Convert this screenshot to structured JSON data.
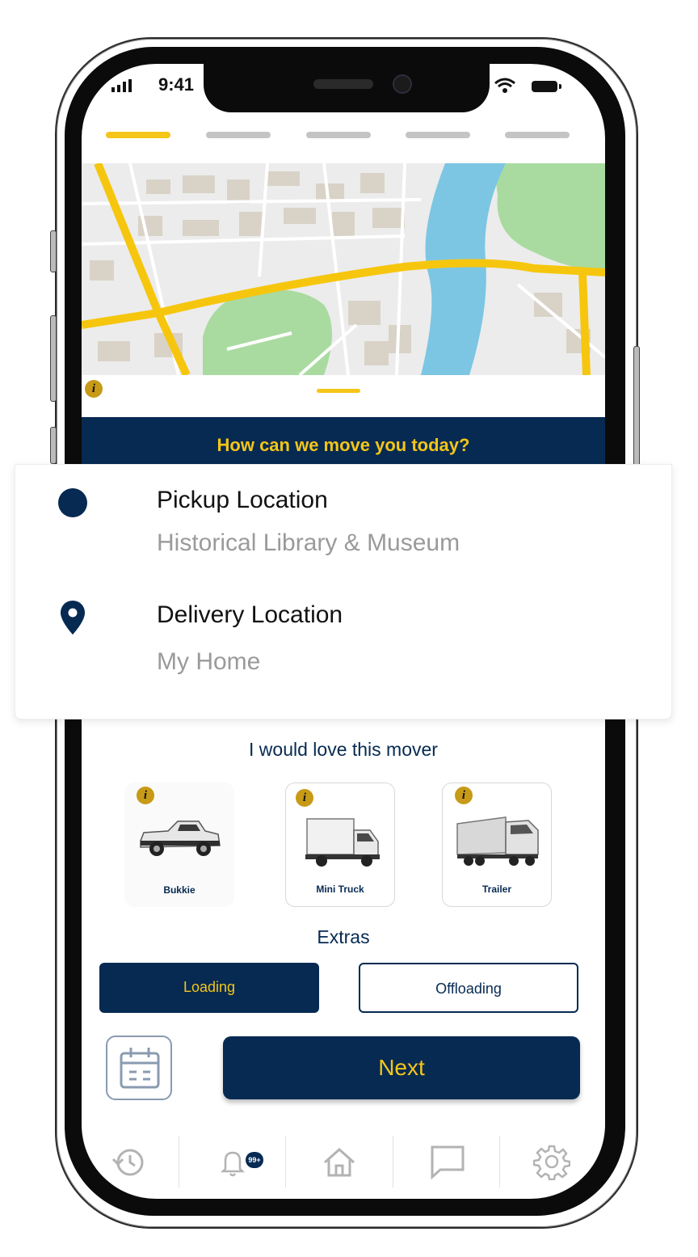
{
  "status_bar": {
    "time": "9:41"
  },
  "progress": {
    "total_steps": 5,
    "current_step": 1
  },
  "banner": {
    "text": "How can we move you today?"
  },
  "locations": {
    "pickup": {
      "title": "Pickup Location",
      "value": "Historical Library & Museum"
    },
    "delivery": {
      "title": "Delivery Location",
      "value": "My Home"
    }
  },
  "mover": {
    "heading": "I would love this mover",
    "vehicles": [
      {
        "label": "Bukkie"
      },
      {
        "label": "Mini Truck"
      },
      {
        "label": "Trailer"
      }
    ]
  },
  "extras": {
    "heading": "Extras",
    "loading_label": "Loading",
    "offloading_label": "Offloading",
    "selected": "Loading"
  },
  "next_label": "Next",
  "tabbar": {
    "notifications_badge": "99+",
    "items": [
      "history-icon",
      "bell-icon",
      "home-icon",
      "chat-icon",
      "gear-icon"
    ]
  },
  "colors": {
    "primary": "#062a52",
    "accent": "#f5c518",
    "info": "#c79a17"
  }
}
